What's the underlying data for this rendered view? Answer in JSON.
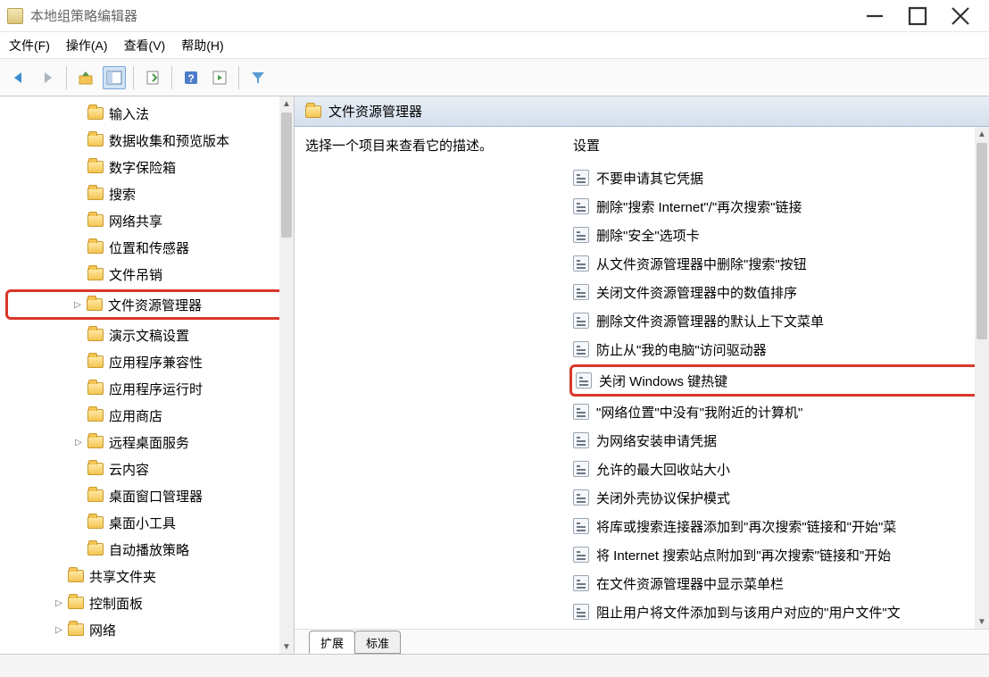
{
  "window": {
    "title": "本地组策略编辑器"
  },
  "menu": {
    "file": "文件(F)",
    "action": "操作(A)",
    "view": "查看(V)",
    "help": "帮助(H)"
  },
  "tree": {
    "items": [
      {
        "indent": 3,
        "exp": "",
        "label": "输入法"
      },
      {
        "indent": 3,
        "exp": "",
        "label": "数据收集和预览版本"
      },
      {
        "indent": 3,
        "exp": "",
        "label": "数字保险箱"
      },
      {
        "indent": 3,
        "exp": "",
        "label": "搜索"
      },
      {
        "indent": 3,
        "exp": "",
        "label": "网络共享"
      },
      {
        "indent": 3,
        "exp": "",
        "label": "位置和传感器"
      },
      {
        "indent": 3,
        "exp": "",
        "label": "文件吊销"
      },
      {
        "indent": 3,
        "exp": ">",
        "label": "文件资源管理器",
        "highlighted": true
      },
      {
        "indent": 3,
        "exp": "",
        "label": "演示文稿设置"
      },
      {
        "indent": 3,
        "exp": "",
        "label": "应用程序兼容性"
      },
      {
        "indent": 3,
        "exp": "",
        "label": "应用程序运行时"
      },
      {
        "indent": 3,
        "exp": "",
        "label": "应用商店"
      },
      {
        "indent": 3,
        "exp": ">",
        "label": "远程桌面服务"
      },
      {
        "indent": 3,
        "exp": "",
        "label": "云内容"
      },
      {
        "indent": 3,
        "exp": "",
        "label": "桌面窗口管理器"
      },
      {
        "indent": 3,
        "exp": "",
        "label": "桌面小工具"
      },
      {
        "indent": 3,
        "exp": "",
        "label": "自动播放策略"
      },
      {
        "indent": 2,
        "exp": "",
        "label": "共享文件夹"
      },
      {
        "indent": 2,
        "exp": ">",
        "label": "控制面板"
      },
      {
        "indent": 2,
        "exp": ">",
        "label": "网络"
      }
    ]
  },
  "details": {
    "header": "文件资源管理器",
    "description": "选择一个项目来查看它的描述。",
    "settings_header": "设置",
    "settings": [
      {
        "label": "不要申请其它凭据"
      },
      {
        "label": "删除\"搜索 Internet\"/\"再次搜索\"链接"
      },
      {
        "label": "删除\"安全\"选项卡"
      },
      {
        "label": "从文件资源管理器中删除\"搜索\"按钮"
      },
      {
        "label": "关闭文件资源管理器中的数值排序"
      },
      {
        "label": "删除文件资源管理器的默认上下文菜单"
      },
      {
        "label": "防止从\"我的电脑\"访问驱动器"
      },
      {
        "label": "关闭 Windows 键热键",
        "highlighted": true
      },
      {
        "label": "\"网络位置\"中没有\"我附近的计算机\""
      },
      {
        "label": "为网络安装申请凭据"
      },
      {
        "label": "允许的最大回收站大小"
      },
      {
        "label": "关闭外壳协议保护模式"
      },
      {
        "label": "将库或搜索连接器添加到\"再次搜索\"链接和\"开始\"菜"
      },
      {
        "label": "将 Internet 搜索站点附加到\"再次搜索\"链接和\"开始"
      },
      {
        "label": "在文件资源管理器中显示菜单栏"
      },
      {
        "label": "阻止用户将文件添加到与该用户对应的\"用户文件\"文"
      }
    ]
  },
  "tabs": {
    "extended": "扩展",
    "standard": "标准"
  }
}
